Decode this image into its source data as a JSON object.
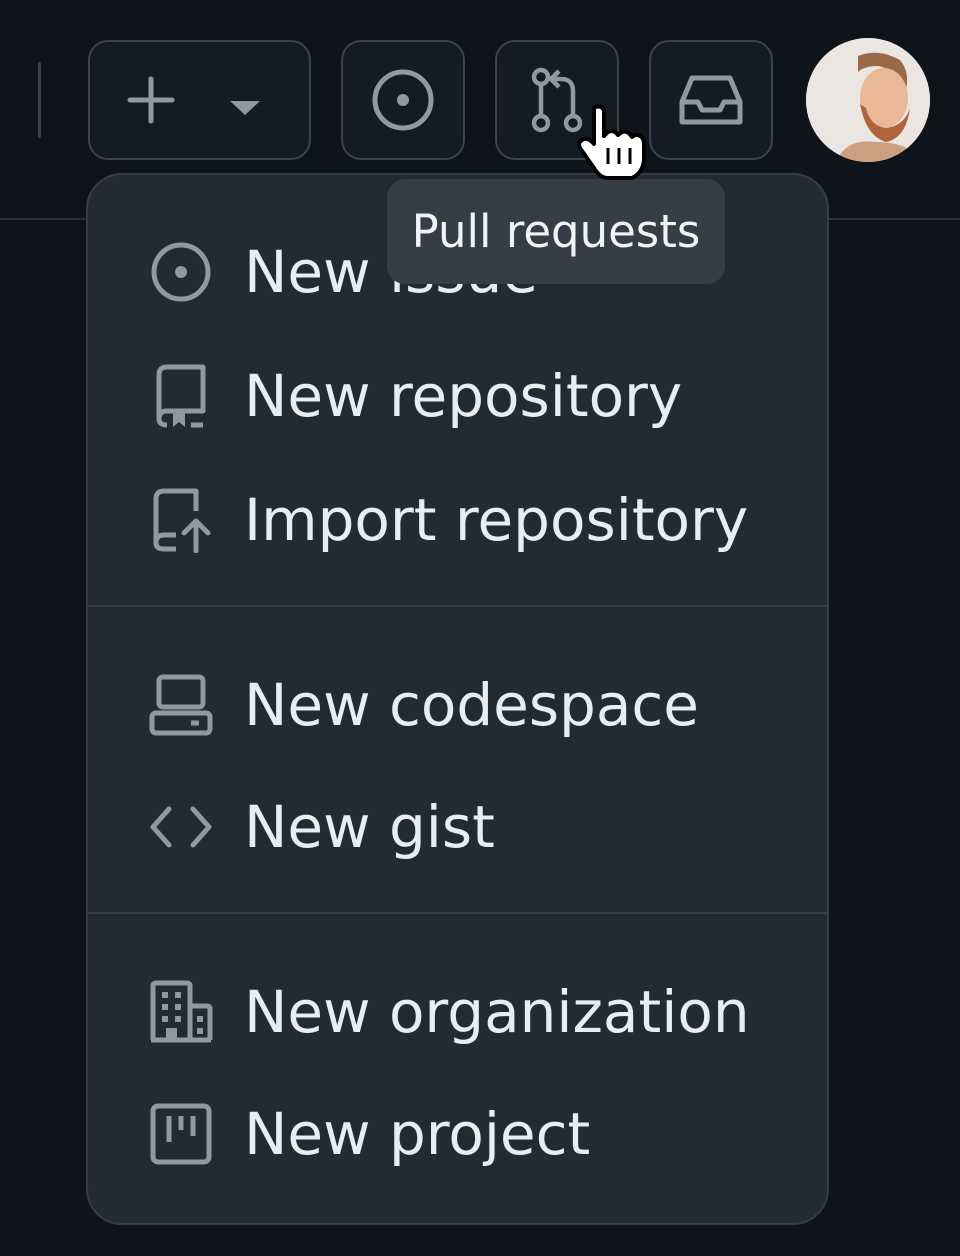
{
  "header": {
    "create_button": {
      "icons": [
        "plus-icon",
        "triangle-down-icon"
      ]
    },
    "issues_button": {
      "icon": "issue-opened-icon"
    },
    "pulls_button": {
      "icon": "git-pull-request-icon"
    },
    "inbox_button": {
      "icon": "inbox-icon"
    },
    "avatar": {
      "alt": "User avatar"
    }
  },
  "tooltip": {
    "text": "Pull requests"
  },
  "menu": {
    "groups": [
      {
        "items": [
          {
            "label": "New issue",
            "icon": "issue-opened-icon"
          },
          {
            "label": "New repository",
            "icon": "repo-icon"
          },
          {
            "label": "Import repository",
            "icon": "repo-push-icon"
          }
        ]
      },
      {
        "items": [
          {
            "label": "New codespace",
            "icon": "codespaces-icon"
          },
          {
            "label": "New gist",
            "icon": "code-icon"
          }
        ]
      },
      {
        "items": [
          {
            "label": "New organization",
            "icon": "organization-icon"
          },
          {
            "label": "New project",
            "icon": "project-icon"
          }
        ]
      }
    ]
  },
  "colors": {
    "page_bg": "#0f141b",
    "menu_bg": "#232a33",
    "border": "#3d444d",
    "icon": "#9198a1",
    "text": "#e6edf3",
    "tooltip_bg": "#363d47"
  }
}
